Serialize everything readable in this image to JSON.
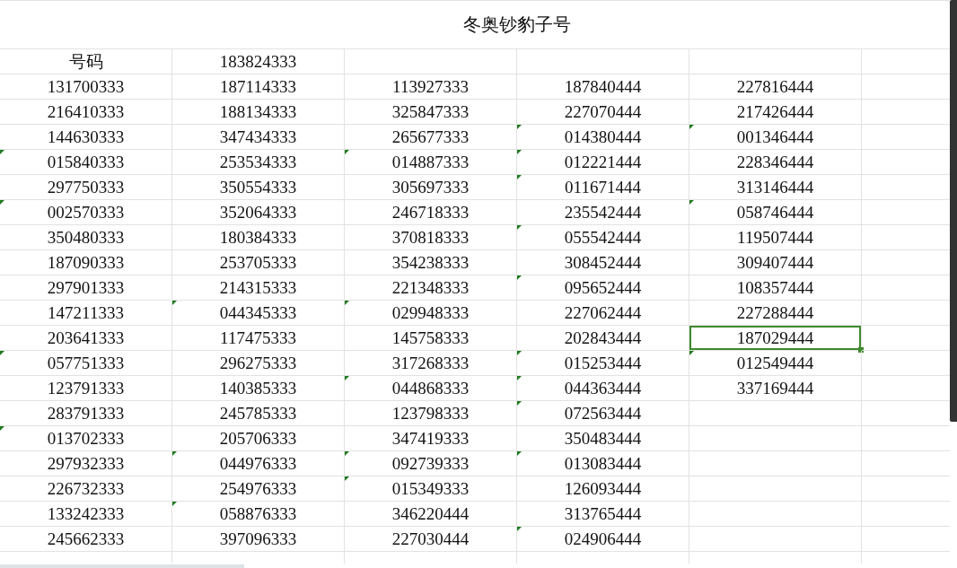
{
  "title": "冬奥钞豹子号",
  "rows": [
    {
      "cells": [
        {
          "text": "号码",
          "flagged": false,
          "selected": false
        },
        {
          "text": "183824333",
          "flagged": false,
          "selected": false
        }
      ]
    },
    {
      "cells": [
        {
          "text": "131700333",
          "flagged": false,
          "selected": false
        },
        {
          "text": "187114333",
          "flagged": false,
          "selected": false
        },
        {
          "text": "113927333",
          "flagged": false,
          "selected": false
        },
        {
          "text": "187840444",
          "flagged": false,
          "selected": false
        },
        {
          "text": "227816444",
          "flagged": false,
          "selected": false
        }
      ]
    },
    {
      "cells": [
        {
          "text": "216410333",
          "flagged": false,
          "selected": false
        },
        {
          "text": "188134333",
          "flagged": false,
          "selected": false
        },
        {
          "text": "325847333",
          "flagged": false,
          "selected": false
        },
        {
          "text": "227070444",
          "flagged": false,
          "selected": false
        },
        {
          "text": "217426444",
          "flagged": false,
          "selected": false
        }
      ]
    },
    {
      "cells": [
        {
          "text": "144630333",
          "flagged": false,
          "selected": false
        },
        {
          "text": "347434333",
          "flagged": false,
          "selected": false
        },
        {
          "text": "265677333",
          "flagged": false,
          "selected": false
        },
        {
          "text": "014380444",
          "flagged": true,
          "selected": false
        },
        {
          "text": "001346444",
          "flagged": true,
          "selected": false
        }
      ]
    },
    {
      "cells": [
        {
          "text": "015840333",
          "flagged": true,
          "selected": false
        },
        {
          "text": "253534333",
          "flagged": false,
          "selected": false
        },
        {
          "text": "014887333",
          "flagged": true,
          "selected": false
        },
        {
          "text": "012221444",
          "flagged": true,
          "selected": false
        },
        {
          "text": "228346444",
          "flagged": false,
          "selected": false
        }
      ]
    },
    {
      "cells": [
        {
          "text": "297750333",
          "flagged": false,
          "selected": false
        },
        {
          "text": "350554333",
          "flagged": false,
          "selected": false
        },
        {
          "text": "305697333",
          "flagged": false,
          "selected": false
        },
        {
          "text": "011671444",
          "flagged": true,
          "selected": false
        },
        {
          "text": "313146444",
          "flagged": false,
          "selected": false
        }
      ]
    },
    {
      "cells": [
        {
          "text": "002570333",
          "flagged": true,
          "selected": false
        },
        {
          "text": "352064333",
          "flagged": false,
          "selected": false
        },
        {
          "text": "246718333",
          "flagged": false,
          "selected": false
        },
        {
          "text": "235542444",
          "flagged": false,
          "selected": false
        },
        {
          "text": "058746444",
          "flagged": true,
          "selected": false
        }
      ]
    },
    {
      "cells": [
        {
          "text": "350480333",
          "flagged": false,
          "selected": false
        },
        {
          "text": "180384333",
          "flagged": false,
          "selected": false
        },
        {
          "text": "370818333",
          "flagged": false,
          "selected": false
        },
        {
          "text": "055542444",
          "flagged": true,
          "selected": false
        },
        {
          "text": "119507444",
          "flagged": false,
          "selected": false
        }
      ]
    },
    {
      "cells": [
        {
          "text": "187090333",
          "flagged": false,
          "selected": false
        },
        {
          "text": "253705333",
          "flagged": false,
          "selected": false
        },
        {
          "text": "354238333",
          "flagged": false,
          "selected": false
        },
        {
          "text": "308452444",
          "flagged": false,
          "selected": false
        },
        {
          "text": "309407444",
          "flagged": false,
          "selected": false
        }
      ]
    },
    {
      "cells": [
        {
          "text": "297901333",
          "flagged": false,
          "selected": false
        },
        {
          "text": "214315333",
          "flagged": false,
          "selected": false
        },
        {
          "text": "221348333",
          "flagged": false,
          "selected": false
        },
        {
          "text": "095652444",
          "flagged": true,
          "selected": false
        },
        {
          "text": "108357444",
          "flagged": false,
          "selected": false
        }
      ]
    },
    {
      "cells": [
        {
          "text": "147211333",
          "flagged": false,
          "selected": false
        },
        {
          "text": "044345333",
          "flagged": true,
          "selected": false
        },
        {
          "text": "029948333",
          "flagged": true,
          "selected": false
        },
        {
          "text": "227062444",
          "flagged": false,
          "selected": false
        },
        {
          "text": "227288444",
          "flagged": false,
          "selected": false
        }
      ]
    },
    {
      "cells": [
        {
          "text": "203641333",
          "flagged": false,
          "selected": false
        },
        {
          "text": "117475333",
          "flagged": false,
          "selected": false
        },
        {
          "text": "145758333",
          "flagged": false,
          "selected": false
        },
        {
          "text": "202843444",
          "flagged": false,
          "selected": false
        },
        {
          "text": "187029444",
          "flagged": false,
          "selected": true
        }
      ]
    },
    {
      "cells": [
        {
          "text": "057751333",
          "flagged": true,
          "selected": false
        },
        {
          "text": "296275333",
          "flagged": false,
          "selected": false
        },
        {
          "text": "317268333",
          "flagged": false,
          "selected": false
        },
        {
          "text": "015253444",
          "flagged": true,
          "selected": false
        },
        {
          "text": "012549444",
          "flagged": true,
          "selected": false
        }
      ]
    },
    {
      "cells": [
        {
          "text": "123791333",
          "flagged": false,
          "selected": false
        },
        {
          "text": "140385333",
          "flagged": false,
          "selected": false
        },
        {
          "text": "044868333",
          "flagged": true,
          "selected": false
        },
        {
          "text": "044363444",
          "flagged": true,
          "selected": false
        },
        {
          "text": "337169444",
          "flagged": false,
          "selected": false
        }
      ]
    },
    {
      "cells": [
        {
          "text": "283791333",
          "flagged": false,
          "selected": false
        },
        {
          "text": "245785333",
          "flagged": false,
          "selected": false
        },
        {
          "text": "123798333",
          "flagged": false,
          "selected": false
        },
        {
          "text": "072563444",
          "flagged": true,
          "selected": false
        }
      ]
    },
    {
      "cells": [
        {
          "text": "013702333",
          "flagged": true,
          "selected": false
        },
        {
          "text": "205706333",
          "flagged": false,
          "selected": false
        },
        {
          "text": "347419333",
          "flagged": false,
          "selected": false
        },
        {
          "text": "350483444",
          "flagged": false,
          "selected": false
        }
      ]
    },
    {
      "cells": [
        {
          "text": "297932333",
          "flagged": false,
          "selected": false
        },
        {
          "text": "044976333",
          "flagged": true,
          "selected": false
        },
        {
          "text": "092739333",
          "flagged": true,
          "selected": false
        },
        {
          "text": "013083444",
          "flagged": true,
          "selected": false
        }
      ]
    },
    {
      "cells": [
        {
          "text": "226732333",
          "flagged": false,
          "selected": false
        },
        {
          "text": "254976333",
          "flagged": false,
          "selected": false
        },
        {
          "text": "015349333",
          "flagged": true,
          "selected": false
        },
        {
          "text": "126093444",
          "flagged": false,
          "selected": false
        }
      ]
    },
    {
      "cells": [
        {
          "text": "133242333",
          "flagged": false,
          "selected": false
        },
        {
          "text": "058876333",
          "flagged": true,
          "selected": false
        },
        {
          "text": "346220444",
          "flagged": false,
          "selected": false
        },
        {
          "text": "313765444",
          "flagged": false,
          "selected": false
        }
      ]
    },
    {
      "cells": [
        {
          "text": "245662333",
          "flagged": false,
          "selected": false
        },
        {
          "text": "397096333",
          "flagged": false,
          "selected": false
        },
        {
          "text": "227030444",
          "flagged": false,
          "selected": false
        },
        {
          "text": "024906444",
          "flagged": true,
          "selected": false
        }
      ]
    }
  ]
}
